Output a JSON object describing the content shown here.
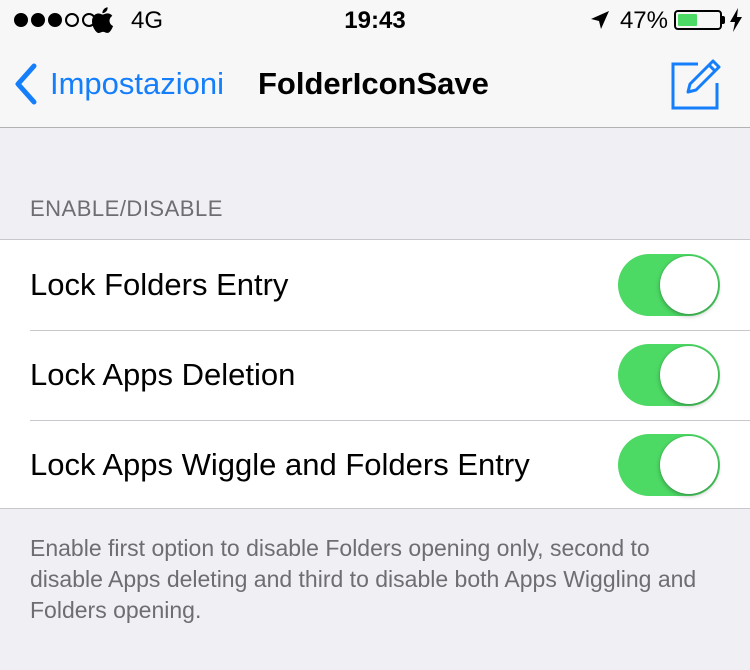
{
  "status_bar": {
    "signal_bars_filled": 3,
    "signal_bars_total": 5,
    "carrier": "4G",
    "time": "19:43",
    "battery_percent": "47%",
    "battery_level": 0.47,
    "icons": [
      "apple-icon",
      "location-icon",
      "battery-icon",
      "charging-bolt-icon"
    ],
    "battery_color": "#4cd964"
  },
  "nav": {
    "back_label": "Impostazioni",
    "title": "FolderIconSave",
    "right_button_icon": "compose-icon",
    "tint_color": "#157efb"
  },
  "section": {
    "header": "ENABLE/DISABLE",
    "rows": [
      {
        "label": "Lock Folders Entry",
        "toggle_on": true
      },
      {
        "label": "Lock Apps Deletion",
        "toggle_on": true
      },
      {
        "label": "Lock Apps Wiggle and Folders Entry",
        "toggle_on": true
      }
    ],
    "footer": "Enable first option to disable Folders opening only, second to disable Apps deleting and third to disable both Apps Wiggling and Folders opening.",
    "toggle_on_color": "#4cd964"
  }
}
